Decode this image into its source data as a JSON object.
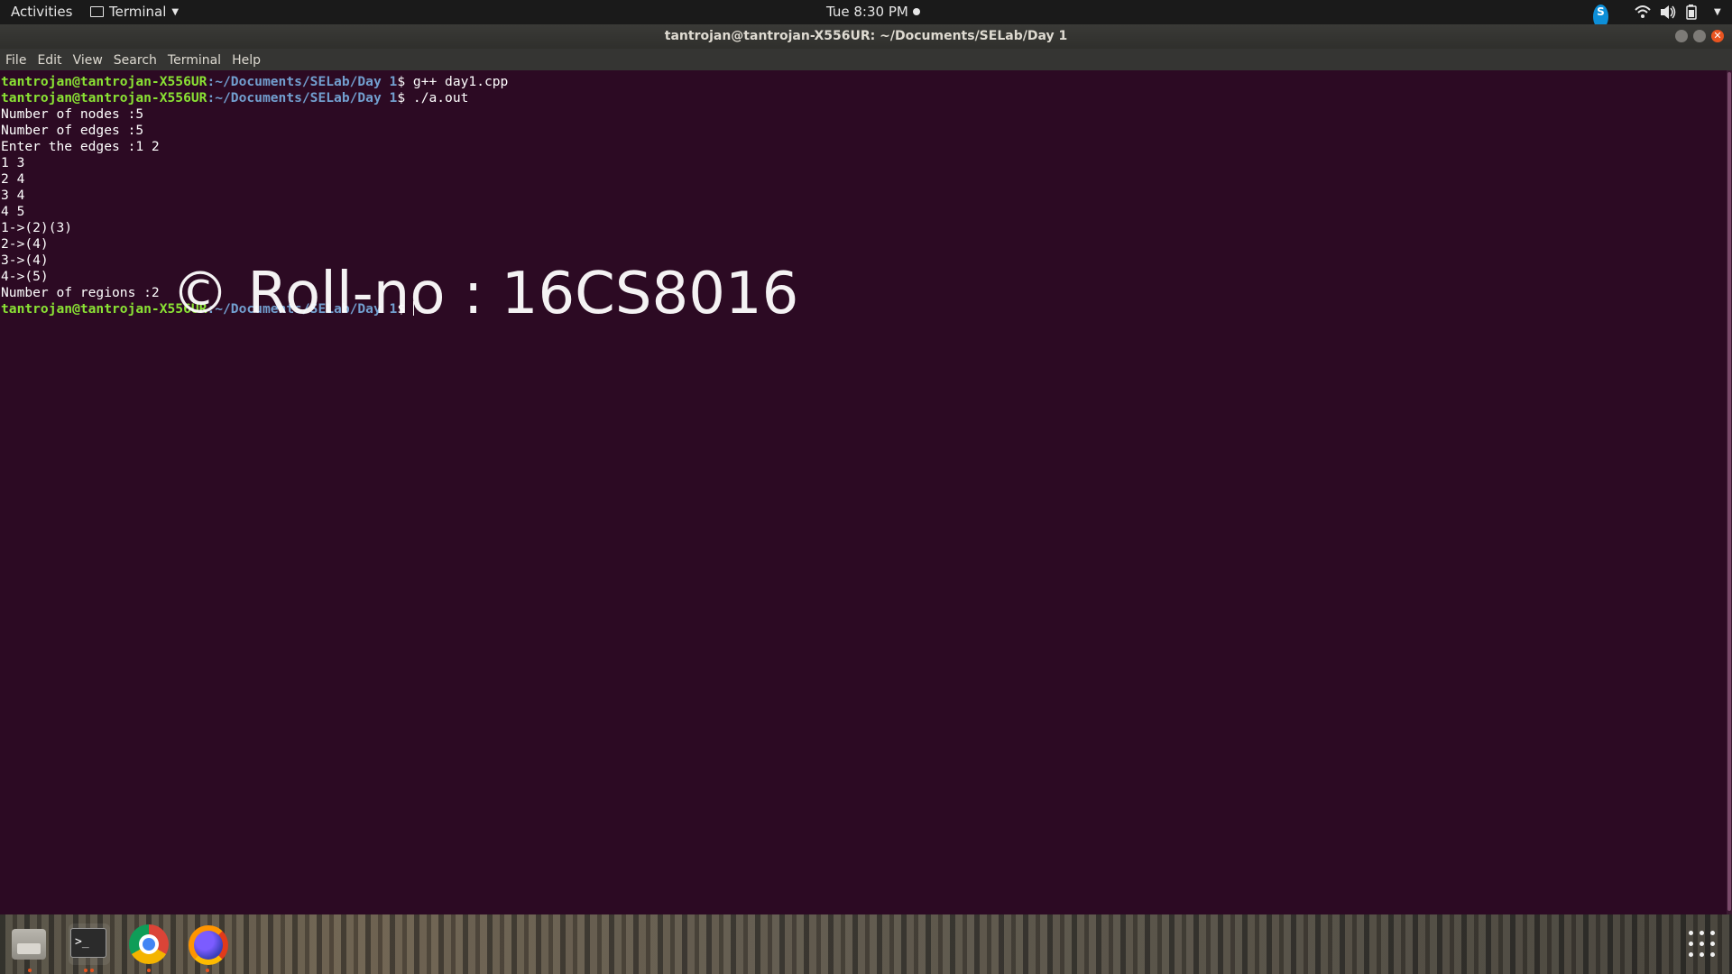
{
  "topbar": {
    "activities": "Activities",
    "app_menu": "Terminal",
    "clock": "Tue  8:30 PM",
    "tray": {
      "skype_letter": "S"
    }
  },
  "window": {
    "title": "tantrojan@tantrojan-X556UR: ~/Documents/SELab/Day 1"
  },
  "menubar": {
    "items": [
      "File",
      "Edit",
      "View",
      "Search",
      "Terminal",
      "Help"
    ]
  },
  "terminal": {
    "prompt_user": "tantrojan@tantrojan-X556UR",
    "prompt_path": ":~/Documents/SELab/Day 1",
    "prompt_symbol": "$ ",
    "commands": [
      "g++ day1.cpp",
      "./a.out"
    ],
    "output": [
      "Number of nodes :5",
      "Number of edges :5",
      "Enter the edges :1 2",
      "1 3",
      "2 4",
      "3 4",
      "4 5",
      "1->(2)(3)",
      "2->(4)",
      "3->(4)",
      "4->(5)",
      "Number of regions :2"
    ]
  },
  "watermark": "© Roll-no : 16CS8016",
  "dock": {
    "apps": [
      "files-icon",
      "terminal-icon",
      "chrome-icon",
      "firefox-icon"
    ],
    "terminal_glyph": ">_"
  },
  "colors": {
    "terminal_bg": "#2c0a23",
    "prompt_user": "#8ae234",
    "prompt_path": "#729fcf",
    "accent": "#e95420"
  }
}
